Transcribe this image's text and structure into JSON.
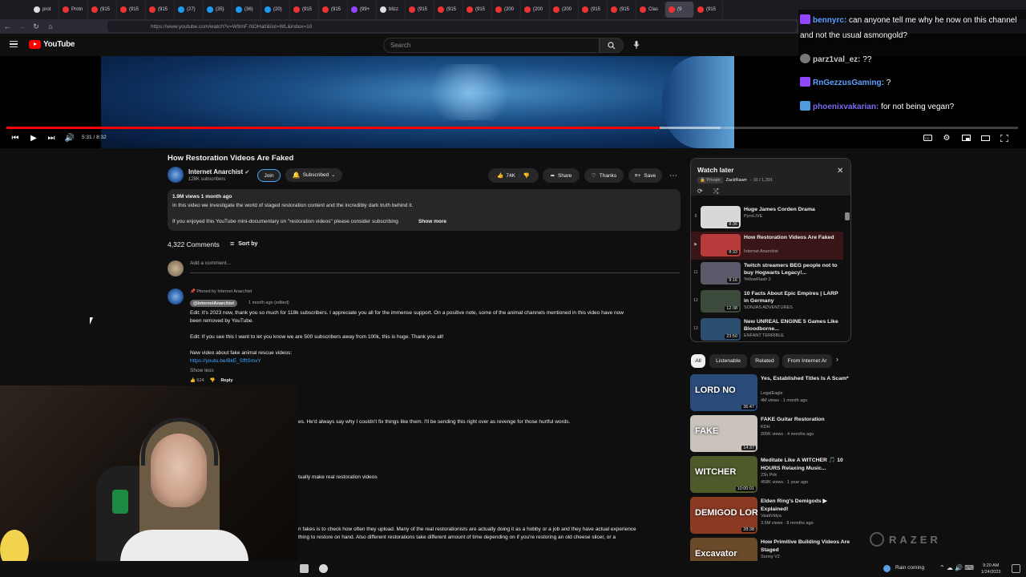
{
  "browser": {
    "tabs": [
      {
        "label": "prot",
        "icon": "github-icon"
      },
      {
        "label": "Protn",
        "icon": "youtube-icon"
      },
      {
        "label": "(915",
        "icon": "youtube-icon"
      },
      {
        "label": "(915",
        "icon": "youtube-icon"
      },
      {
        "label": "(915",
        "icon": "youtube-icon"
      },
      {
        "label": "(27)",
        "icon": "twitter-icon"
      },
      {
        "label": "(35)",
        "icon": "twitter-icon"
      },
      {
        "label": "(36)",
        "icon": "twitter-icon"
      },
      {
        "label": "(20)",
        "icon": "twitter-icon"
      },
      {
        "label": "(915",
        "icon": "youtube-icon"
      },
      {
        "label": "(915",
        "icon": "youtube-icon"
      },
      {
        "label": "(99+",
        "icon": "twitch-icon"
      },
      {
        "label": "blizz",
        "icon": "github-icon"
      },
      {
        "label": "(915",
        "icon": "youtube-icon"
      },
      {
        "label": "(915",
        "icon": "youtube-icon"
      },
      {
        "label": "(915",
        "icon": "youtube-icon"
      },
      {
        "label": "(200",
        "icon": "youtube-icon"
      },
      {
        "label": "(200",
        "icon": "youtube-icon"
      },
      {
        "label": "(200",
        "icon": "youtube-icon"
      },
      {
        "label": "(915",
        "icon": "youtube-icon"
      },
      {
        "label": "(915",
        "icon": "youtube-icon"
      },
      {
        "label": "Clas",
        "icon": "youtube-icon"
      },
      {
        "label": "(9",
        "icon": "youtube-icon",
        "active": true
      },
      {
        "label": "(915",
        "icon": "youtube-icon"
      }
    ],
    "url": "https://www.youtube.com/watch?v=W9mF-NOHatI&list=WL&index=10"
  },
  "header": {
    "logo": "YouTube",
    "search_placeholder": "Search"
  },
  "player": {
    "time": "5:31 / 8:32",
    "progress_fraction": 0.646
  },
  "chat": [
    {
      "user": "bennyrc:",
      "message": "can anyone tell me why he now on this channel",
      "badge": "prime"
    },
    {
      "user": "",
      "message": "and not the usual asmongold?",
      "badge": ""
    },
    {
      "user": "parz1val_ez:",
      "message": "??",
      "badge": "avatar"
    },
    {
      "user": "RnGezzusGaming:",
      "message": "?",
      "badge": "prime"
    },
    {
      "user": "phoenixvakarian:",
      "message": "for not being vegan?",
      "badge": "sub"
    }
  ],
  "video": {
    "title": "How Restoration Videos Are Faked",
    "channel": "Internet Anarchist",
    "subscribers": "128K subscribers",
    "join_label": "Join",
    "subscribed_label": "Subscribed",
    "likes": "74K",
    "share_label": "Share",
    "thanks_label": "Thanks",
    "save_label": "Save"
  },
  "description": {
    "meta": "1.9M views  1 month ago",
    "line1": "In this video we investigate the world of staged restoration content and the incredibly dark truth behind it.",
    "line2": "If you enjoyed this YouTube mini-documentary on \"restoration videos\" please consider subscribing",
    "show_more": "Show more"
  },
  "comments": {
    "count": "4,322 Comments",
    "sort_label": "Sort by",
    "add_placeholder": "Add a comment...",
    "pinned": {
      "pinned_by": "Pinned by Internet Anarchist",
      "author": "@InternetAnarchist",
      "time": "1 month ago (edited)",
      "line1": "Edit: It's 2023 now, thank you so much for 118k subscribers. I appreciate you all for the immense support. On a positive note, some of the animal channels mentioned in this video have now",
      "line2": "been removed by YouTube.",
      "line3": "Edit: If you see this I want to let you know we are 500 subscribers away from 100k, this is huge. Thank you all!",
      "line4": "New video about fake animal rescue videos:",
      "link": "https://youtu.be/BkE_SfftSmxY",
      "show_less": "Show less",
      "likes": "624",
      "reply": "Reply"
    },
    "partial": [
      "es. He'd always say why I couldn't fix things like them. I'll be sending this right over as revenge for those hurtful words.",
      "tually make real restoration videos",
      "n fakes is to check how often they upload.  Many of the real restorationists are actually doing it as a hobby or a job and they have actual experience",
      "thing to restore on hand.  Also different restorations take different amount of time depending on if you're restoring an old cheese slicer, or a"
    ]
  },
  "playlist": {
    "title": "Watch later",
    "privacy": "Private",
    "owner": "ZackRawrr",
    "position": "- 10 / 1,391",
    "items": [
      {
        "num": "9",
        "title": "Huge James Corden Drama",
        "channel": "PyroLIVE",
        "duration": "8:36",
        "color": "#d8d8d8"
      },
      {
        "num": "▶",
        "title": "How Restoration Videos Are Faked",
        "channel": "Internet Anarchist",
        "duration": "8:33",
        "color": "#b73b3b",
        "active": true
      },
      {
        "num": "11",
        "title": "Twitch streamers BEG people not to buy Hogwarts Legacy!...",
        "channel": "YellowFlash 2",
        "duration": "9:16",
        "color": "#5a5a6a"
      },
      {
        "num": "12",
        "title": "10 Facts About Epic Empires | LARP in Germany",
        "channel": "SONJAS ADVENTURES",
        "duration": "12:38",
        "color": "#3b4a3a"
      },
      {
        "num": "13",
        "title": "New UNREAL ENGINE 5 Games Like Bloodborne...",
        "channel": "ENFANT TERRIBLE",
        "duration": "23:50",
        "color": "#2b4d6e"
      }
    ]
  },
  "chips": [
    "All",
    "Listenable",
    "Related",
    "From Internet Ar"
  ],
  "recommendations": [
    {
      "title": "Yes, Established Titles Is A Scam*",
      "channel": "LegalEagle",
      "stats": "4M views · 1 month ago",
      "duration": "36:47",
      "color": "#2a4b7a",
      "thumb_text": "LORD  NO"
    },
    {
      "title": "FAKE Guitar Restoration",
      "channel": "KDH",
      "stats": "205K views · 4 months ago",
      "duration": "14:37",
      "color": "#c9c3bb",
      "thumb_text": "FAKE"
    },
    {
      "title": "Meditate Like A WITCHER 🎵 10 HOURS Relaxing Music...",
      "channel": "23n Pnk",
      "stats": "458K views · 1 year ago",
      "duration": "10:00:01",
      "color": "#4d5a2a",
      "thumb_text": "WITCHER"
    },
    {
      "title": "Elden Ring's Demigods ▶ Explained!",
      "channel": "VaatiVidya",
      "stats": "3.5M views · 8 months ago",
      "duration": "28:38",
      "color": "#8b3a24",
      "thumb_text": "DEMIGOD LORE"
    },
    {
      "title": "How Primitive Building Videos Are Staged",
      "channel": "Sunny V2",
      "stats": "",
      "duration": "",
      "color": "#6b4a2a",
      "thumb_text": "Excavator"
    }
  ],
  "watermark": "RAZER",
  "taskbar": {
    "weather": "Rain coming",
    "time": "9:20 AM",
    "date": "1/24/2023"
  }
}
